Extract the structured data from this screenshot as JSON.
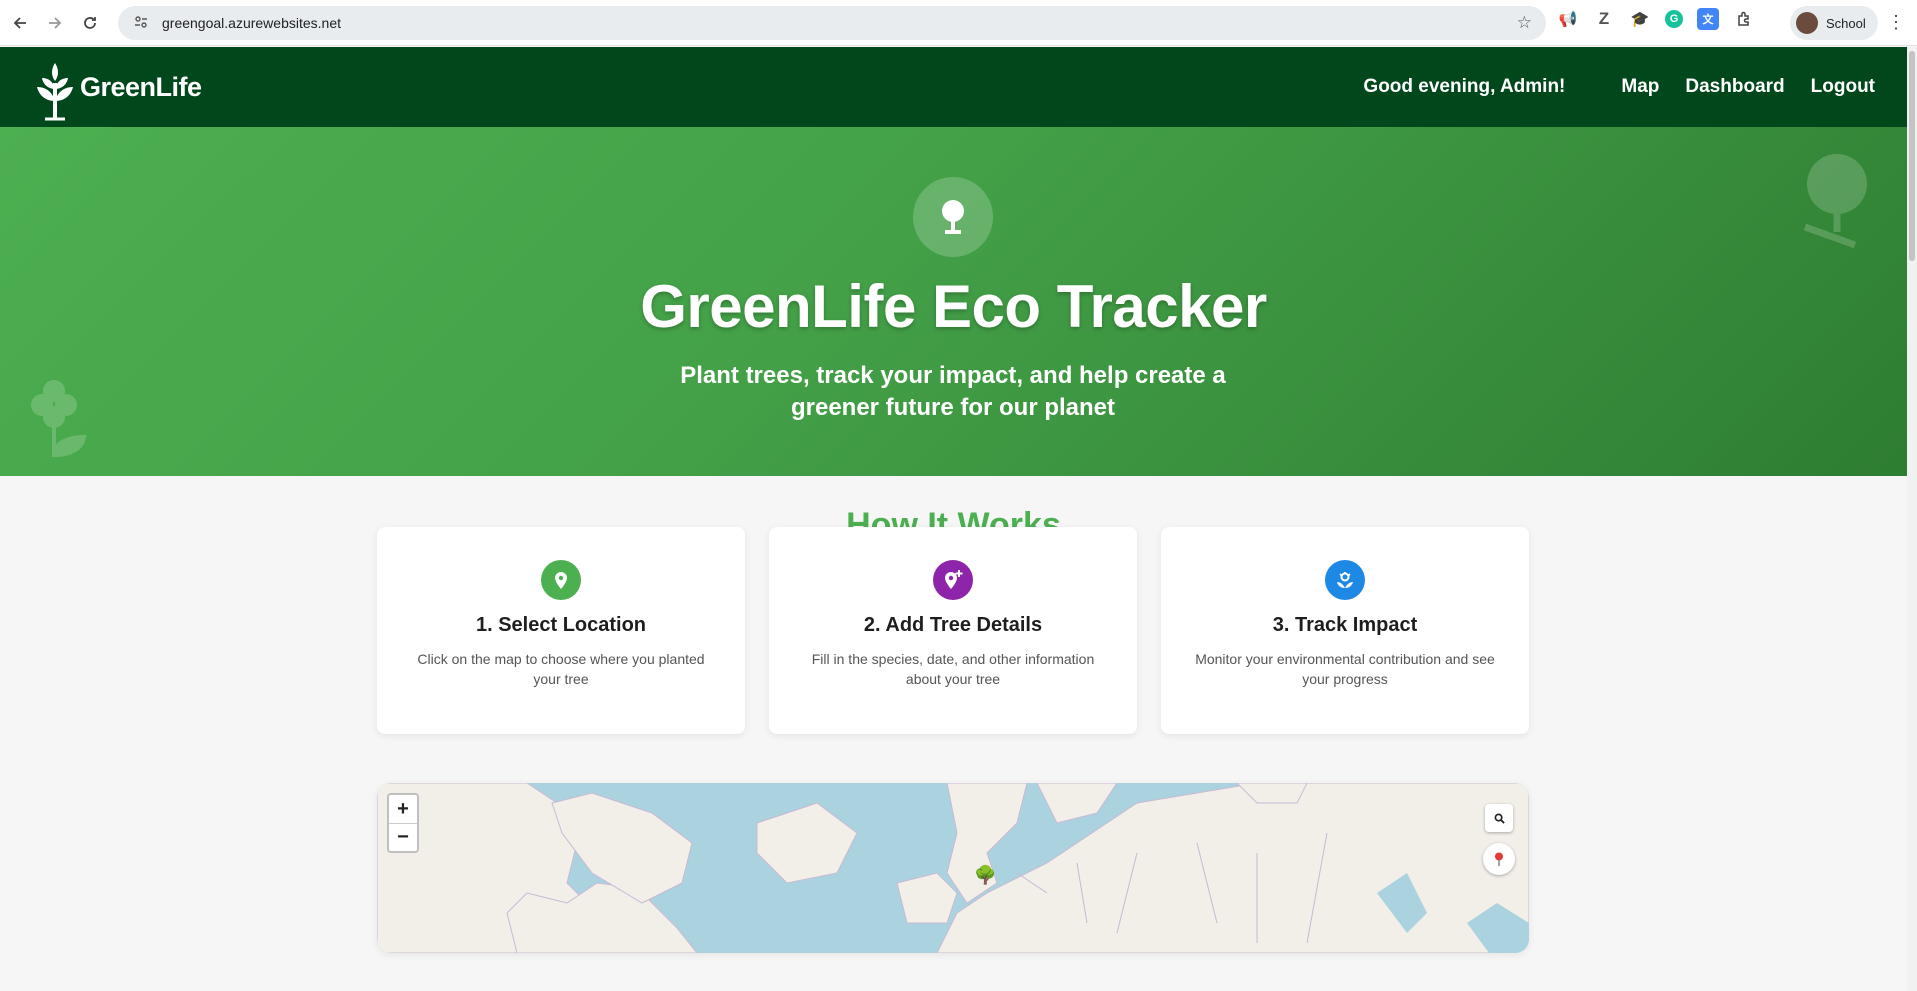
{
  "browser": {
    "url": "greengoal.azurewebsites.net",
    "profile_name": "School",
    "back_icon": "arrow-left-icon",
    "forward_icon": "arrow-right-icon",
    "reload_icon": "reload-icon"
  },
  "nav": {
    "brand": "GreenLife",
    "greeting": "Good evening, Admin!",
    "links": [
      "Map",
      "Dashboard",
      "Logout"
    ]
  },
  "hero": {
    "title": "GreenLife Eco Tracker",
    "subtitle": "Plant trees, track your impact, and help create a greener future for our planet"
  },
  "how_it_works": {
    "title": "How It Works",
    "steps": [
      {
        "title": "1. Select Location",
        "desc": "Click on the map to choose where you planted your tree",
        "color": "#4caf50",
        "icon": "map-pin-icon"
      },
      {
        "title": "2. Add Tree Details",
        "desc": "Fill in the species, date, and other information about your tree",
        "color": "#8e24aa",
        "icon": "add-location-icon"
      },
      {
        "title": "3. Track Impact",
        "desc": "Monitor your environmental contribution and see your progress",
        "color": "#1e88e5",
        "icon": "seedling-icon"
      }
    ]
  },
  "map": {
    "zoom_in": "+",
    "zoom_out": "−",
    "search_icon": "search-icon",
    "locate_icon": "location-pin-icon",
    "marker_icon": "tree-marker-icon"
  },
  "colors": {
    "nav_bg": "#00471b",
    "hero_from": "#4caf50",
    "hero_to": "#2e7d32",
    "accent": "#4caf50"
  }
}
